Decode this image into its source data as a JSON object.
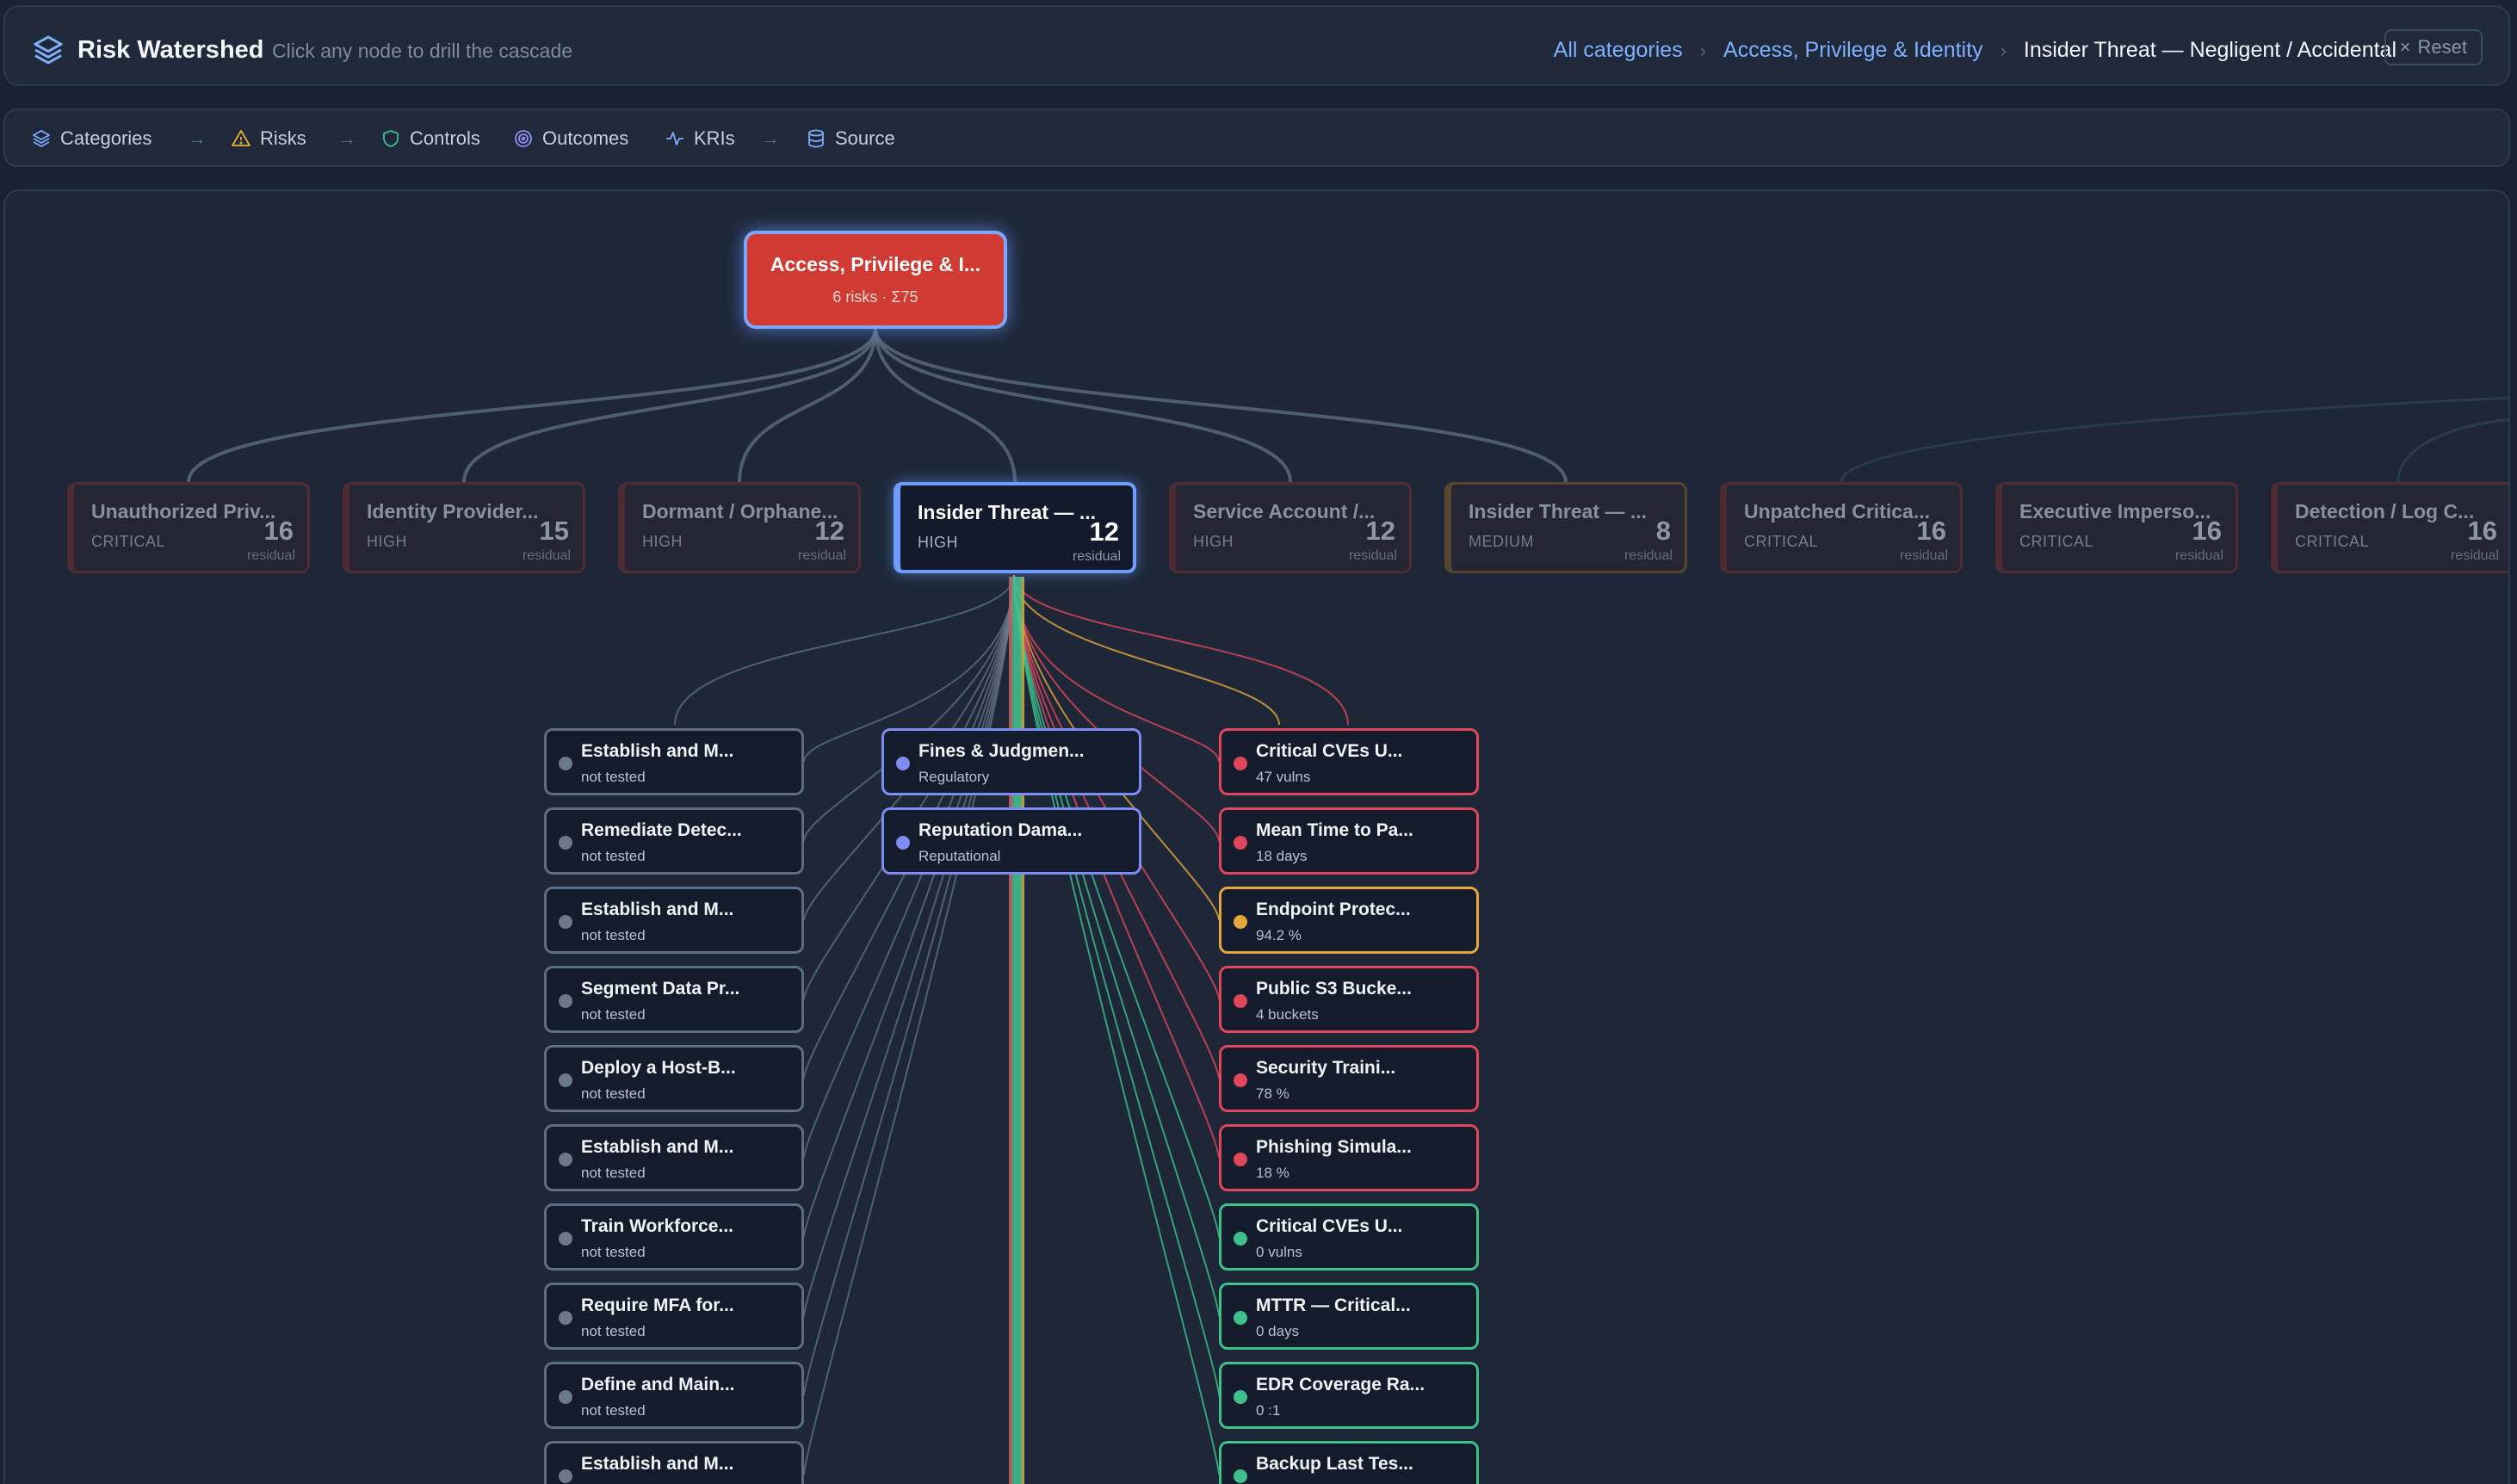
{
  "header": {
    "title": "Risk Watershed",
    "subtitle": "Click any node to drill the cascade",
    "breadcrumbs": [
      "All categories",
      "Access, Privilege & Identity",
      "Insider Threat — Negligent / Accidental"
    ],
    "reset_label": "Reset",
    "reset_icon": "×"
  },
  "stages": [
    {
      "label": "Categories",
      "icon": "layers-icon"
    },
    {
      "label": "Risks",
      "icon": "warning-icon"
    },
    {
      "label": "Controls",
      "icon": "shield-icon"
    },
    {
      "label": "Outcomes",
      "icon": "target-icon"
    },
    {
      "label": "KRIs",
      "icon": "pulse-icon"
    },
    {
      "label": "Source",
      "icon": "database-icon"
    }
  ],
  "category": {
    "title": "Access, Privilege & I...",
    "meta": "6 risks · Σ75"
  },
  "risks": [
    {
      "title": "Unauthorized Priv...",
      "severity": "CRITICAL",
      "score": "16",
      "unit": "residual"
    },
    {
      "title": "Identity Provider...",
      "severity": "HIGH",
      "score": "15",
      "unit": "residual"
    },
    {
      "title": "Dormant / Orphane...",
      "severity": "HIGH",
      "score": "12",
      "unit": "residual"
    },
    {
      "title": "Insider Threat — ...",
      "severity": "HIGH",
      "score": "12",
      "unit": "residual"
    },
    {
      "title": "Service Account /...",
      "severity": "HIGH",
      "score": "12",
      "unit": "residual"
    },
    {
      "title": "Insider Threat — ...",
      "severity": "MEDIUM",
      "score": "8",
      "unit": "residual"
    },
    {
      "title": "Unpatched Critica...",
      "severity": "CRITICAL",
      "score": "16",
      "unit": "residual"
    },
    {
      "title": "Executive Imperso...",
      "severity": "CRITICAL",
      "score": "16",
      "unit": "residual"
    },
    {
      "title": "Detection / Log C...",
      "severity": "CRITICAL",
      "score": "16",
      "unit": "residual"
    }
  ],
  "controls": [
    {
      "title": "Establish and M...",
      "status": "not tested"
    },
    {
      "title": "Remediate Detec...",
      "status": "not tested"
    },
    {
      "title": "Establish and M...",
      "status": "not tested"
    },
    {
      "title": "Segment Data Pr...",
      "status": "not tested"
    },
    {
      "title": "Deploy a Host-B...",
      "status": "not tested"
    },
    {
      "title": "Establish and M...",
      "status": "not tested"
    },
    {
      "title": "Train Workforce...",
      "status": "not tested"
    },
    {
      "title": "Require MFA for...",
      "status": "not tested"
    },
    {
      "title": "Define and Main...",
      "status": "not tested"
    },
    {
      "title": "Establish and M...",
      "status": ""
    }
  ],
  "outcomes": [
    {
      "title": "Fines & Judgmen...",
      "type": "Regulatory"
    },
    {
      "title": "Reputation Dama...",
      "type": "Reputational"
    }
  ],
  "kris": [
    {
      "title": "Critical CVEs U...",
      "value": "47 vulns",
      "status": "red"
    },
    {
      "title": "Mean Time to Pa...",
      "value": "18 days",
      "status": "red"
    },
    {
      "title": "Endpoint Protec...",
      "value": "94.2 %",
      "status": "amber"
    },
    {
      "title": "Public S3 Bucke...",
      "value": "4 buckets",
      "status": "red"
    },
    {
      "title": "Security Traini...",
      "value": "78 %",
      "status": "red"
    },
    {
      "title": "Phishing Simula...",
      "value": "18 %",
      "status": "red"
    },
    {
      "title": "Critical CVEs U...",
      "value": "0 vulns",
      "status": "green"
    },
    {
      "title": "MTTR — Critical...",
      "value": "0 days",
      "status": "green"
    },
    {
      "title": "EDR Coverage Ra...",
      "value": "0 :1",
      "status": "green"
    },
    {
      "title": "Backup Last Tes...",
      "value": "",
      "status": "green"
    }
  ],
  "colors": {
    "background": "#1a2232",
    "category": "#cf3a32",
    "selected": "#6f9dff",
    "critical": "#e0475b",
    "warning": "#e6a83c",
    "ok": "#3fbf8c",
    "outcome": "#7d8cf2"
  }
}
